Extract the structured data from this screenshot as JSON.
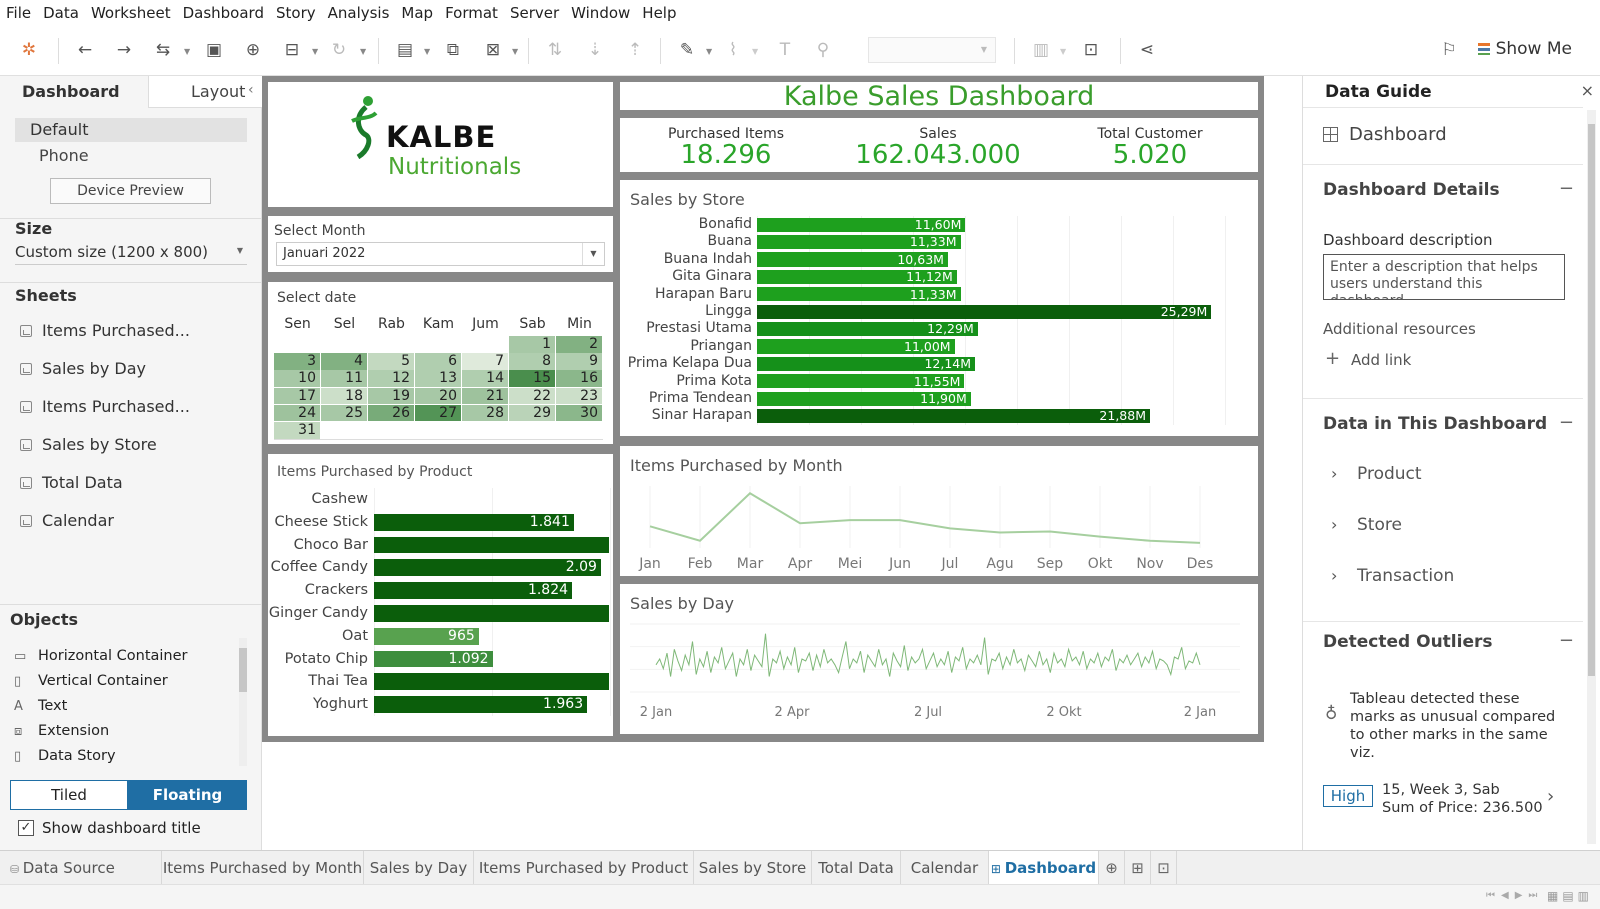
{
  "menu": [
    "File",
    "Data",
    "Worksheet",
    "Dashboard",
    "Story",
    "Analysis",
    "Map",
    "Format",
    "Server",
    "Window",
    "Help"
  ],
  "toolbar": {
    "show_me": "Show Me"
  },
  "left": {
    "tab_dashboard": "Dashboard",
    "tab_layout": "Layout",
    "collapse_glyph": "‹",
    "device_default": "Default",
    "device_phone": "Phone",
    "device_preview": "Device Preview",
    "size_title": "Size",
    "size_value": "Custom size (1200 x 800)",
    "sheets_title": "Sheets",
    "sheets": [
      "Items Purchased...",
      "Sales by Day",
      "Items Purchased...",
      "Sales by Store",
      "Total Data",
      "Calendar"
    ],
    "objects_title": "Objects",
    "objects": [
      "Horizontal Container",
      "Vertical Container",
      "Text",
      "Extension",
      "Data Story"
    ],
    "tiled": "Tiled",
    "floating": "Floating",
    "show_title": "Show dashboard title"
  },
  "dashboard": {
    "logo_word": "KALBE",
    "logo_sub": "Nutritionals",
    "title": "Kalbe Sales Dashboard",
    "kpis": [
      {
        "label": "Purchased Items",
        "value": "18.296"
      },
      {
        "label": "Sales",
        "value": "162.043.000"
      },
      {
        "label": "Total Customer",
        "value": "5.020"
      }
    ],
    "select_month_title": "Select Month",
    "select_month_value": "Januari 2022",
    "select_date_title": "Select date",
    "weekdays": [
      "Sen",
      "Sel",
      "Rab",
      "Kam",
      "Jum",
      "Sab",
      "Min"
    ],
    "items_by_product_title": "Items Purchased by Product",
    "sales_by_store_title": "Sales by Store",
    "items_by_month_title": "Items Purchased by Month",
    "sales_by_day_title": "Sales by Day",
    "sales_by_day_ticks": [
      "2 Jan",
      "2 Apr",
      "2 Jul",
      "2 Okt",
      "2 Jan"
    ]
  },
  "calendar": {
    "weeks": [
      [
        "",
        "",
        "",
        "",
        "",
        "1",
        "2"
      ],
      [
        "3",
        "4",
        "5",
        "6",
        "7",
        "8",
        "9"
      ],
      [
        "10",
        "11",
        "12",
        "13",
        "14",
        "15",
        "16"
      ],
      [
        "17",
        "18",
        "19",
        "20",
        "21",
        "22",
        "23"
      ],
      [
        "24",
        "25",
        "26",
        "27",
        "28",
        "29",
        "30"
      ],
      [
        "31",
        "",
        "",
        "",
        "",
        "",
        ""
      ]
    ],
    "intensity": [
      [
        null,
        null,
        null,
        null,
        null,
        0.35,
        0.55
      ],
      [
        0.55,
        0.55,
        0.2,
        0.3,
        0.05,
        0.3,
        0.3
      ],
      [
        0.35,
        0.35,
        0.3,
        0.3,
        0.3,
        0.85,
        0.5
      ],
      [
        0.35,
        0.15,
        0.35,
        0.35,
        0.4,
        0.15,
        0.15
      ],
      [
        0.4,
        0.35,
        0.6,
        0.8,
        0.35,
        0.25,
        0.5
      ],
      [
        0.2,
        null,
        null,
        null,
        null,
        null,
        null
      ]
    ]
  },
  "right": {
    "title": "Data Guide",
    "close": "×",
    "dashboard_label": "Dashboard",
    "details_title": "Dashboard Details",
    "desc_label": "Dashboard description",
    "desc_placeholder": "Enter a description that helps users understand this dashboard",
    "resources_label": "Additional resources",
    "add_link": "Add link",
    "data_title": "Data in This Dashboard",
    "data_items": [
      "Product",
      "Store",
      "Transaction"
    ],
    "outliers_title": "Detected Outliers",
    "outliers_text": "Tableau detected these marks as unusual compared to other marks in the same viz.",
    "outlier_badge": "High",
    "outlier_line1": "15, Week 3, Sab",
    "outlier_line2": "Sum of Price: 236.500"
  },
  "tabs": {
    "data_source": "Data Source",
    "sheets": [
      "Items Purchased by Month",
      "Sales by Day",
      "Items Purchased by Product",
      "Sales by Store",
      "Total Data",
      "Calendar",
      "Dashboard"
    ]
  },
  "colors": {
    "dark_green": "#0b5e0b",
    "mid_green": "#1e9a1e",
    "bright_green": "#2aa52a",
    "title_green": "#3a9d2c",
    "accent_blue": "#1f6ea4"
  },
  "chart_data": [
    {
      "type": "bar",
      "title": "Sales by Store",
      "orientation": "horizontal",
      "categories": [
        "Bonafid",
        "Buana",
        "Buana Indah",
        "Gita Ginara",
        "Harapan Baru",
        "Lingga",
        "Prestasi Utama",
        "Priangan",
        "Prima Kelapa Dua",
        "Prima Kota",
        "Prima Tendean",
        "Sinar Harapan"
      ],
      "values": [
        11.6,
        11.33,
        10.63,
        11.12,
        11.33,
        25.29,
        12.29,
        11.0,
        12.14,
        11.55,
        11.9,
        21.88
      ],
      "labels": [
        "11,60M",
        "11,33M",
        "10,63M",
        "11,12M",
        "11,33M",
        "25,29M",
        "12,29M",
        "11,00M",
        "12,14M",
        "11,55M",
        "11,90M",
        "21,88M"
      ],
      "xlim": [
        0,
        26.5
      ]
    },
    {
      "type": "bar",
      "title": "Items Purchased by Product",
      "orientation": "horizontal",
      "categories": [
        "Cashew",
        "Cheese Stick",
        "Choco Bar",
        "Coffee Candy",
        "Crackers",
        "Ginger Candy",
        "Oat",
        "Potato Chip",
        "Thai Tea",
        "Yoghurt"
      ],
      "values": [
        null,
        1841,
        3300,
        2090,
        1824,
        2650,
        965,
        1092,
        3100,
        1963
      ],
      "labels": [
        "",
        "1.841",
        "",
        "2.09",
        "1.824",
        "",
        "965",
        "1.092",
        "",
        "1.963"
      ],
      "xlim": [
        0,
        2100
      ]
    },
    {
      "type": "line",
      "title": "Items Purchased by Month",
      "categories": [
        "Jan",
        "Feb",
        "Mar",
        "Apr",
        "Mei",
        "Jun",
        "Jul",
        "Agu",
        "Sep",
        "Okt",
        "Nov",
        "Des"
      ],
      "values": [
        1560,
        1420,
        1880,
        1590,
        1620,
        1620,
        1540,
        1500,
        1510,
        1460,
        1420,
        1400
      ],
      "ylim": [
        1350,
        1950
      ]
    },
    {
      "type": "line",
      "title": "Sales by Day",
      "x_ticks": [
        "2 Jan",
        "2 Apr",
        "2 Jul",
        "2 Okt",
        "2 Jan"
      ],
      "values": [
        440,
        470,
        420,
        500,
        380,
        520,
        460,
        410,
        490,
        440,
        560,
        390,
        470,
        430,
        510,
        400,
        480,
        450,
        530,
        420,
        460,
        500,
        380,
        470,
        440,
        520,
        410,
        490,
        460,
        430,
        600,
        380,
        470,
        450,
        510,
        420,
        480,
        440,
        530,
        400,
        470,
        460,
        500,
        410,
        490,
        430,
        520,
        450,
        470,
        440,
        400,
        480,
        560,
        420,
        470,
        450,
        510,
        400,
        490,
        460,
        430,
        520,
        440,
        470,
        380,
        500,
        460,
        430,
        540,
        410,
        480,
        450,
        470,
        520,
        420,
        460,
        500,
        430,
        470,
        440,
        510,
        400,
        480,
        460,
        530,
        420,
        470,
        450,
        490,
        440,
        580,
        390,
        470,
        460,
        500,
        420,
        480,
        440,
        520,
        450,
        470,
        410,
        490,
        460,
        430,
        510,
        440,
        470,
        400,
        500,
        450,
        470,
        430,
        520,
        460,
        480,
        440,
        510,
        420,
        470,
        450,
        500,
        430,
        480,
        460,
        520,
        410,
        470,
        450,
        490,
        440,
        470,
        500,
        430,
        480,
        450,
        510,
        420,
        470,
        460,
        440,
        390,
        480,
        470,
        530,
        420,
        460,
        450,
        500,
        440
      ],
      "ylim": [
        300,
        650
      ]
    }
  ]
}
